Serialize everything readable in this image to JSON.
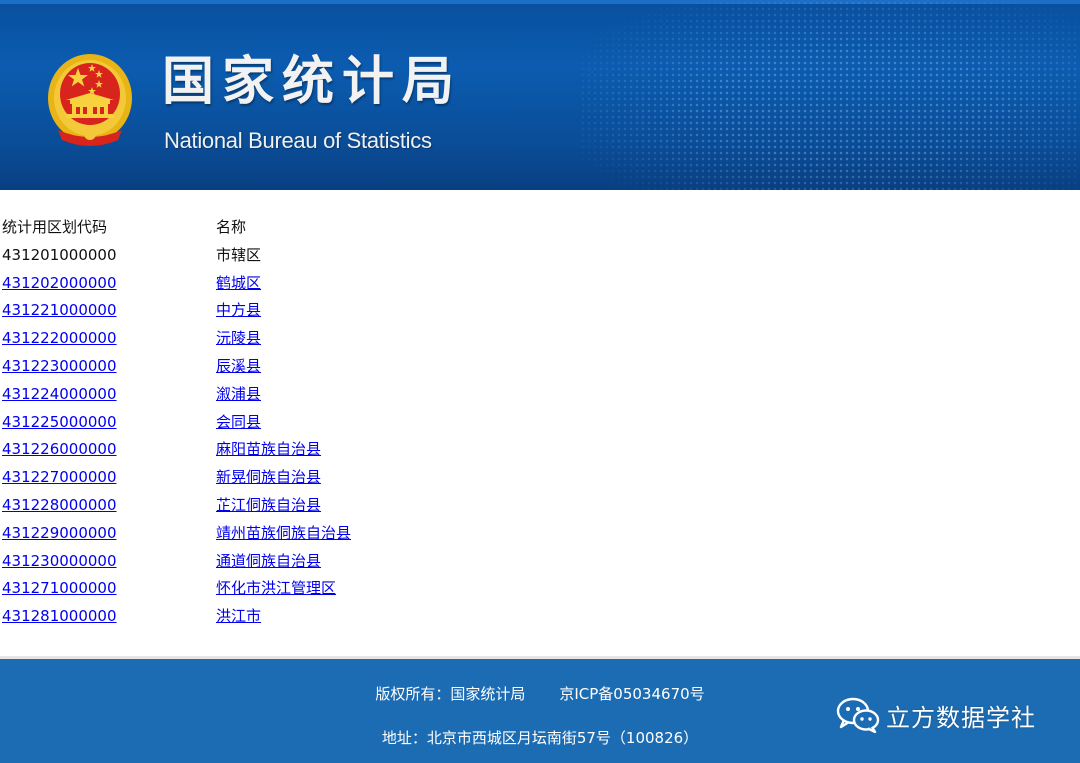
{
  "header": {
    "title_cn": "国家统计局",
    "title_en": "National Bureau of Statistics",
    "emblem_icon": "national-emblem-icon",
    "background_color": "#0b5cb0"
  },
  "table": {
    "headers": {
      "code": "统计用区划代码",
      "name": "名称"
    },
    "rows": [
      {
        "code": "431201000000",
        "name": "市辖区",
        "link": false
      },
      {
        "code": "431202000000",
        "name": "鹤城区",
        "link": true
      },
      {
        "code": "431221000000",
        "name": "中方县",
        "link": true
      },
      {
        "code": "431222000000",
        "name": "沅陵县",
        "link": true
      },
      {
        "code": "431223000000",
        "name": "辰溪县",
        "link": true
      },
      {
        "code": "431224000000",
        "name": "溆浦县",
        "link": true
      },
      {
        "code": "431225000000",
        "name": "会同县",
        "link": true
      },
      {
        "code": "431226000000",
        "name": "麻阳苗族自治县",
        "link": true
      },
      {
        "code": "431227000000",
        "name": "新晃侗族自治县",
        "link": true
      },
      {
        "code": "431228000000",
        "name": "芷江侗族自治县",
        "link": true
      },
      {
        "code": "431229000000",
        "name": "靖州苗族侗族自治县",
        "link": true
      },
      {
        "code": "431230000000",
        "name": "通道侗族自治县",
        "link": true
      },
      {
        "code": "431271000000",
        "name": "怀化市洪江管理区",
        "link": true
      },
      {
        "code": "431281000000",
        "name": "洪江市",
        "link": true
      }
    ],
    "link_color": "#0000ee"
  },
  "footer": {
    "copyright": "版权所有：国家统计局",
    "icp": "京ICP备05034670号",
    "address": "地址：北京市西城区月坛南街57号（100826）",
    "background_color": "#1c6cb3"
  },
  "watermark": {
    "text": "立方数据学社",
    "icon": "wechat-icon"
  }
}
